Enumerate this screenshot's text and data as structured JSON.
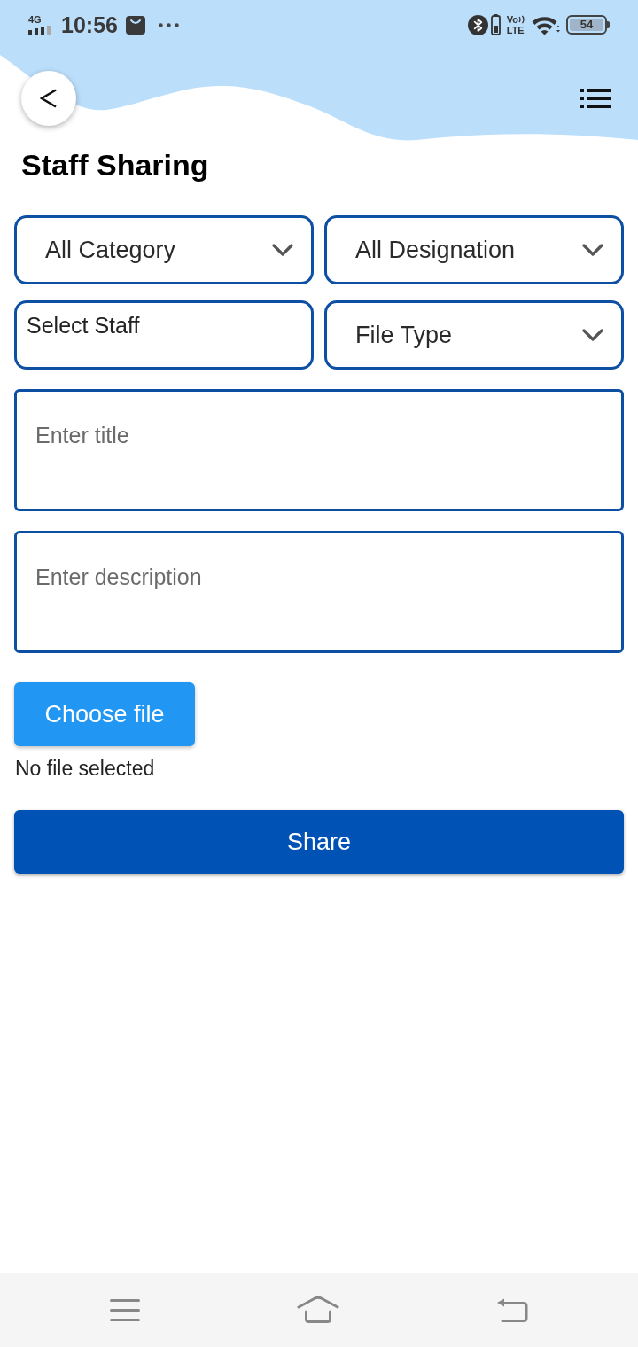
{
  "status_bar": {
    "network": "4G",
    "time": "10:56",
    "volte": {
      "top": "Vo",
      "bottom": "LTE"
    },
    "battery": "54"
  },
  "header": {
    "title": "Staff Sharing"
  },
  "filters": [
    {
      "kind": "select",
      "label": "All Category"
    },
    {
      "kind": "select",
      "label": "All Designation"
    },
    {
      "kind": "multiselect",
      "placeholder": "Select Staff"
    },
    {
      "kind": "select",
      "label": "File Type"
    }
  ],
  "fields": [
    {
      "placeholder": "Enter title"
    },
    {
      "placeholder": "Enter description"
    }
  ],
  "file_picker": {
    "button": "Choose file",
    "status": "No file selected"
  },
  "submit": "Share"
}
